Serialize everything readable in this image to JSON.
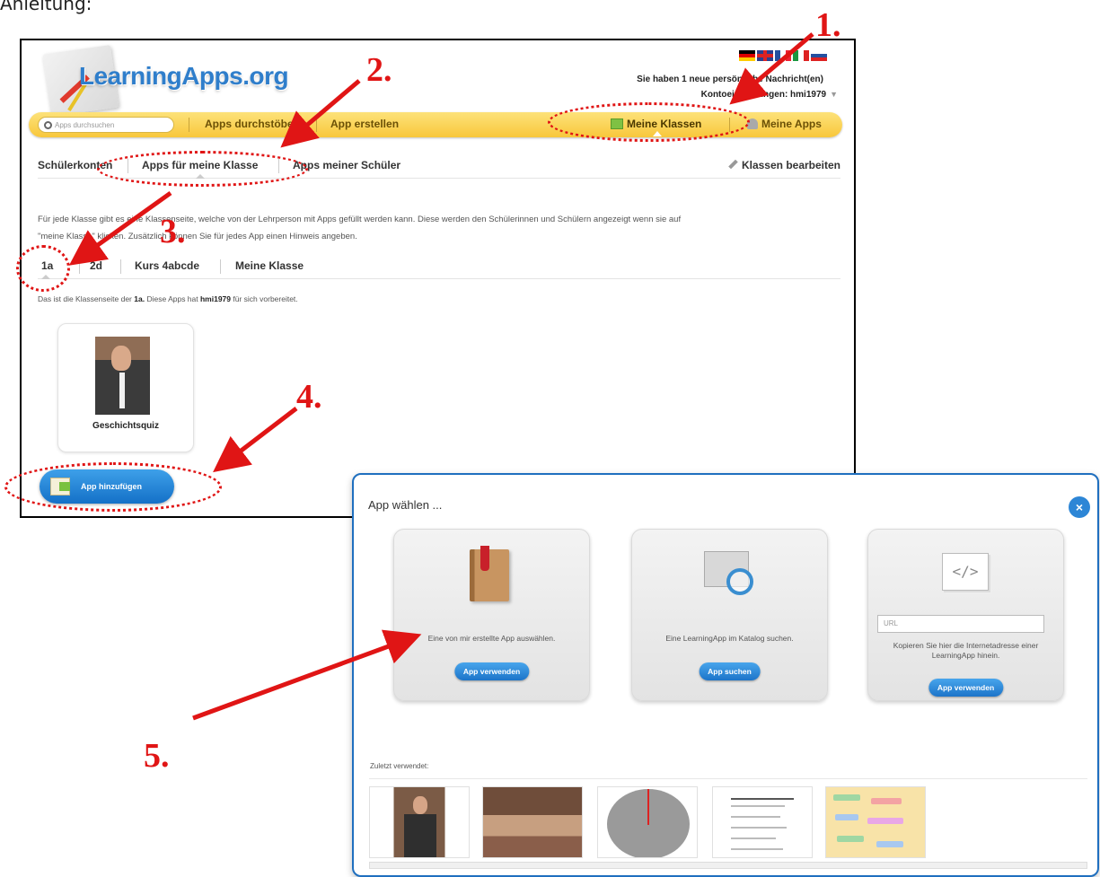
{
  "heading_fragment": "Anleitung:",
  "site": {
    "logo": "LearningApps.org",
    "messages": "Sie haben 1 neue persönliche Nachricht(en)",
    "account": "Kontoeinstellungen: hmi1979"
  },
  "navbar": {
    "search_placeholder": "Apps durchsuchen",
    "browse": "Apps durchstöbern",
    "create": "App erstellen",
    "my_classes": "Meine Klassen",
    "my_apps": "Meine Apps"
  },
  "subtabs": {
    "student_accounts": "Schülerkonten",
    "apps_for_class": "Apps für meine Klasse",
    "student_apps": "Apps meiner Schüler",
    "edit_classes": "Klassen bearbeiten"
  },
  "description": {
    "line1": "Für jede Klasse gibt es eine Klassenseite, welche von der Lehrperson mit Apps gefüllt werden kann. Diese werden den Schülerinnen und Schülern angezeigt wenn sie auf",
    "line2": "\"meine Klasse\" klicken. Zusätzlich können Sie für jedes App einen Hinweis angeben."
  },
  "class_tabs": [
    "1a",
    "2d",
    "Kurs 4abcde",
    "Meine Klasse"
  ],
  "class_note": {
    "prefix": "Das ist die Klassenseite der ",
    "class": "1a.",
    "middle": " Diese Apps hat ",
    "user": "hmi1979",
    "suffix": " für sich vorbereitet."
  },
  "app_card": {
    "name": "Geschichtsquiz"
  },
  "add_app_button": "App hinzufügen",
  "dialog": {
    "title": "App wählen ...",
    "close": "×",
    "options": [
      {
        "text": "Eine von mir erstellte App auswählen.",
        "button": "App verwenden"
      },
      {
        "text": "Eine LearningApp im Katalog suchen.",
        "button": "App suchen"
      },
      {
        "input_placeholder": "URL",
        "text": "Kopieren Sie hier die Internetadresse einer LearningApp hinein.",
        "button": "App verwenden"
      }
    ],
    "recent_label": "Zuletzt verwendet:"
  },
  "annotations": [
    "1.",
    "2.",
    "3.",
    "4.",
    "5."
  ],
  "colors": {
    "annotation": "#e01515",
    "navbar": "#f8c73b",
    "button_blue": "#1c74c9"
  }
}
